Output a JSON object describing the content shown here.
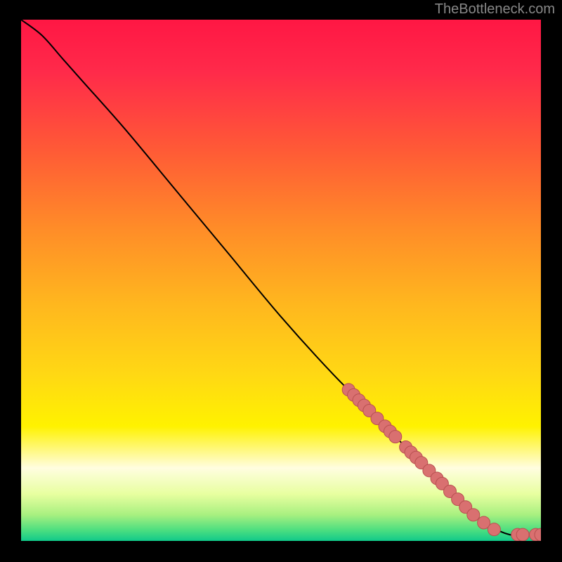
{
  "attribution": "TheBottleneck.com",
  "chart_data": {
    "type": "line",
    "title": "",
    "xlabel": "",
    "ylabel": "",
    "xlim": [
      0,
      100
    ],
    "ylim": [
      0,
      100
    ],
    "curve": [
      {
        "x": 0,
        "y": 100
      },
      {
        "x": 4,
        "y": 97
      },
      {
        "x": 8,
        "y": 92.5
      },
      {
        "x": 12,
        "y": 88
      },
      {
        "x": 20,
        "y": 79
      },
      {
        "x": 30,
        "y": 67
      },
      {
        "x": 40,
        "y": 55
      },
      {
        "x": 50,
        "y": 43
      },
      {
        "x": 60,
        "y": 32
      },
      {
        "x": 70,
        "y": 22
      },
      {
        "x": 80,
        "y": 12
      },
      {
        "x": 85,
        "y": 7
      },
      {
        "x": 90,
        "y": 3
      },
      {
        "x": 94,
        "y": 1.2
      },
      {
        "x": 97,
        "y": 1.2
      },
      {
        "x": 100,
        "y": 1.2
      }
    ],
    "markers": [
      {
        "x": 63,
        "y": 29
      },
      {
        "x": 64,
        "y": 28
      },
      {
        "x": 65,
        "y": 27
      },
      {
        "x": 66,
        "y": 26
      },
      {
        "x": 67,
        "y": 25
      },
      {
        "x": 68.5,
        "y": 23.5
      },
      {
        "x": 70,
        "y": 22
      },
      {
        "x": 71,
        "y": 21
      },
      {
        "x": 72,
        "y": 20
      },
      {
        "x": 74,
        "y": 18
      },
      {
        "x": 75,
        "y": 17
      },
      {
        "x": 76,
        "y": 16
      },
      {
        "x": 77,
        "y": 15
      },
      {
        "x": 78.5,
        "y": 13.5
      },
      {
        "x": 80,
        "y": 12
      },
      {
        "x": 81,
        "y": 11
      },
      {
        "x": 82.5,
        "y": 9.5
      },
      {
        "x": 84,
        "y": 8
      },
      {
        "x": 85.5,
        "y": 6.5
      },
      {
        "x": 87,
        "y": 5
      },
      {
        "x": 89,
        "y": 3.5
      },
      {
        "x": 91,
        "y": 2.2
      },
      {
        "x": 95.5,
        "y": 1.2
      },
      {
        "x": 96.5,
        "y": 1.2
      },
      {
        "x": 99,
        "y": 1.2
      },
      {
        "x": 100,
        "y": 1.2
      }
    ],
    "gradient_stops": [
      {
        "offset": 0,
        "color": "#ff1744"
      },
      {
        "offset": 0.1,
        "color": "#ff2a4a"
      },
      {
        "offset": 0.25,
        "color": "#ff5a36"
      },
      {
        "offset": 0.4,
        "color": "#ff8c28"
      },
      {
        "offset": 0.55,
        "color": "#ffb81e"
      },
      {
        "offset": 0.68,
        "color": "#ffd814"
      },
      {
        "offset": 0.78,
        "color": "#fff200"
      },
      {
        "offset": 0.86,
        "color": "#fffde0"
      },
      {
        "offset": 0.91,
        "color": "#e8ffa0"
      },
      {
        "offset": 0.95,
        "color": "#a8f080"
      },
      {
        "offset": 0.98,
        "color": "#4ade80"
      },
      {
        "offset": 1.0,
        "color": "#10c98a"
      }
    ],
    "marker_color": "#d97070",
    "marker_stroke": "#b85050",
    "line_color": "#000000"
  }
}
